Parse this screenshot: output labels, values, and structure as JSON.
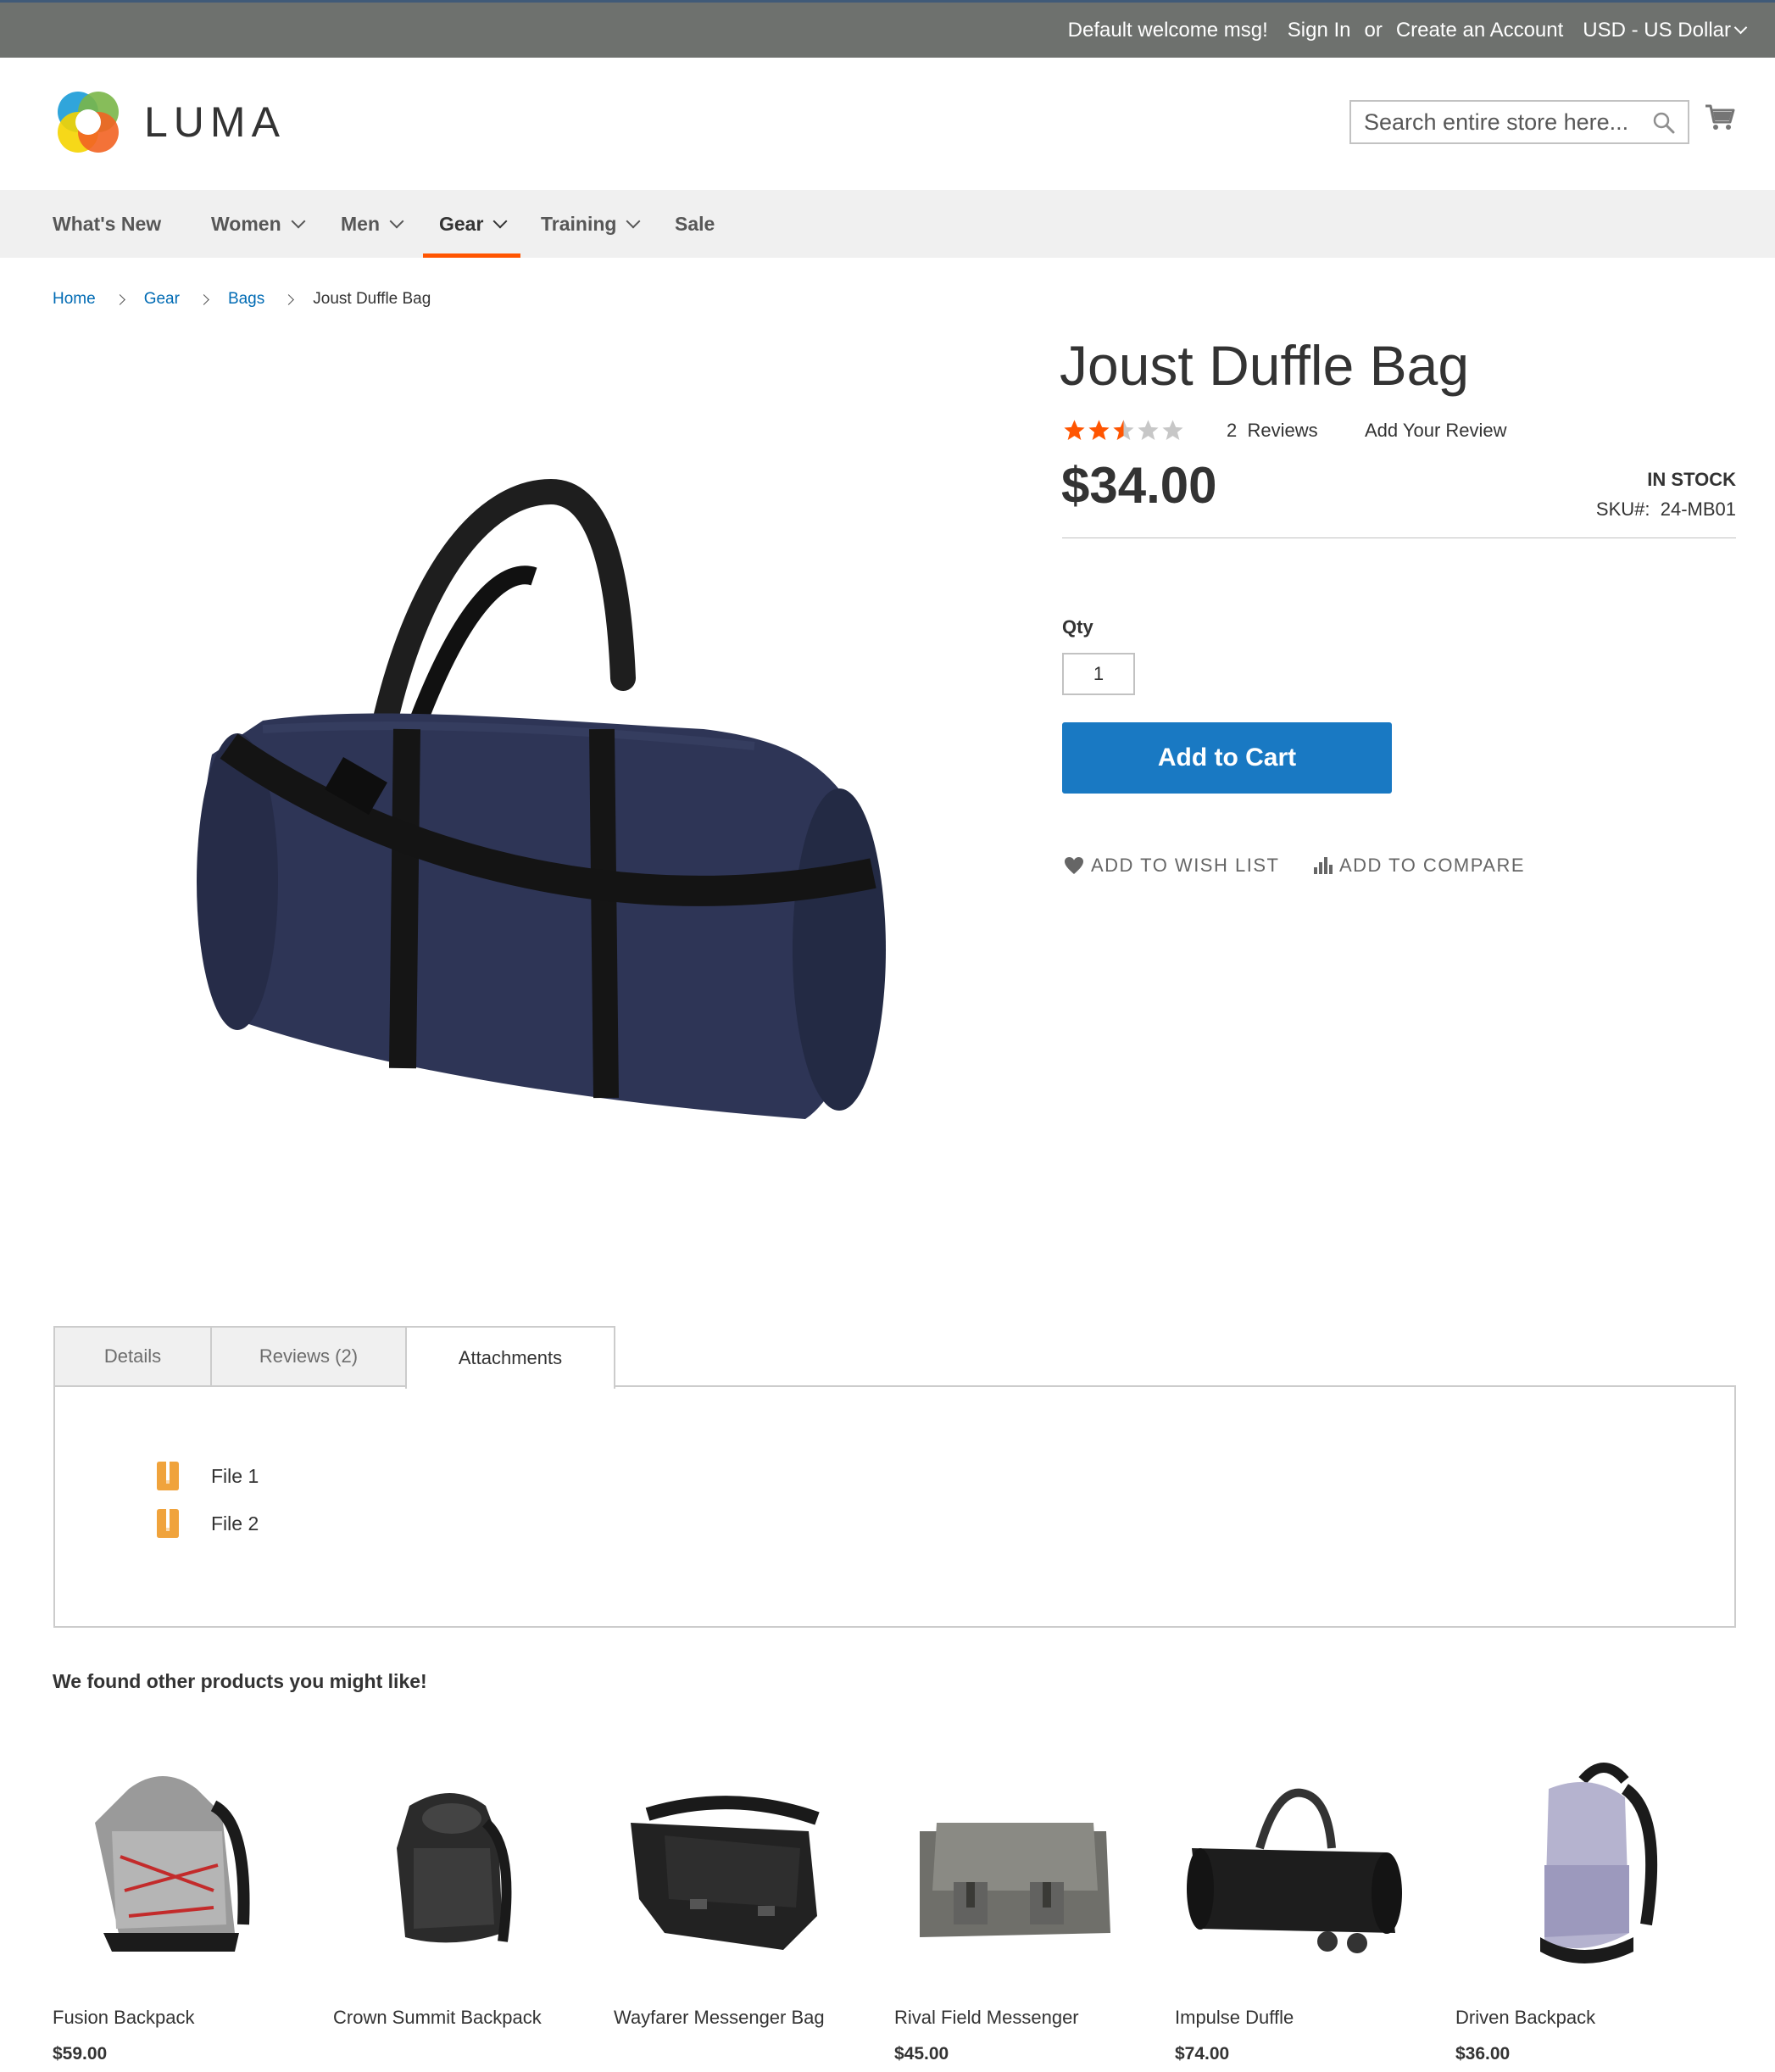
{
  "top_bar": {
    "welcome": "Default welcome msg!",
    "sign_in": "Sign In",
    "or": "or",
    "create_account": "Create an Account",
    "currency": "USD - US Dollar"
  },
  "header": {
    "logo_text": "LUMA",
    "search_placeholder": "Search entire store here...",
    "brand_colors": [
      "#f26322",
      "#7ab648",
      "#f5d400",
      "#1a9bd7"
    ]
  },
  "nav": {
    "items": [
      {
        "label": "What's New",
        "has_dropdown": false,
        "active": false
      },
      {
        "label": "Women",
        "has_dropdown": true,
        "active": false
      },
      {
        "label": "Men",
        "has_dropdown": true,
        "active": false
      },
      {
        "label": "Gear",
        "has_dropdown": true,
        "active": true
      },
      {
        "label": "Training",
        "has_dropdown": true,
        "active": false
      },
      {
        "label": "Sale",
        "has_dropdown": false,
        "active": false
      }
    ]
  },
  "breadcrumb": {
    "items": [
      "Home",
      "Gear",
      "Bags"
    ],
    "current": "Joust Duffle Bag"
  },
  "product": {
    "title": "Joust Duffle Bag",
    "rating_stars": 2.5,
    "rating_max": 5,
    "reviews_count": "2",
    "reviews_label": "Reviews",
    "add_review": "Add Your Review",
    "price": "$34.00",
    "stock": "IN STOCK",
    "sku_label": "SKU#:",
    "sku": "24-MB01",
    "qty_label": "Qty",
    "qty_value": "1",
    "add_to_cart": "Add to Cart",
    "wishlist": "Add to Wish List",
    "compare": "Add to Compare",
    "image_icon": "navy-duffle-bag-image"
  },
  "tabs": {
    "items": [
      "Details",
      "Reviews (2)",
      "Attachments"
    ],
    "active": "Attachments",
    "attachments": [
      "File 1",
      "File 2"
    ]
  },
  "related": {
    "title": "We found other products you might like!",
    "products": [
      {
        "name": "Fusion Backpack",
        "price": "$59.00"
      },
      {
        "name": "Crown Summit Backpack",
        "price": ""
      },
      {
        "name": "Wayfarer Messenger Bag",
        "price": ""
      },
      {
        "name": "Rival Field Messenger",
        "price": "$45.00"
      },
      {
        "name": "Impulse Duffle",
        "price": "$74.00"
      },
      {
        "name": "Driven Backpack",
        "price": "$36.00"
      }
    ]
  },
  "colors": {
    "top_bar": "#6e716e",
    "nav_bg": "#f0f0f0",
    "nav_active_underline": "#ff5501",
    "primary_button": "#1979c3",
    "link": "#006bb4",
    "star_filled": "#ff5501",
    "star_empty": "#c7c7c7",
    "file_icon": "#f0a33c"
  }
}
